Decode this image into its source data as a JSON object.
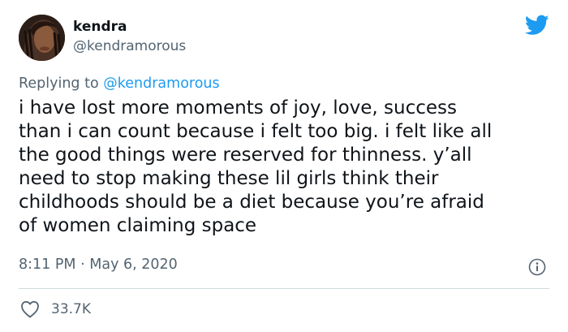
{
  "author": {
    "name": "kendra",
    "handle": "@kendramorous"
  },
  "reply": {
    "prefix": "Replying to",
    "mention": "@kendramorous"
  },
  "tweet": {
    "text": "i have lost more moments of joy, love, success\nthan i can count because i felt too big. i felt like all\nthe good things were reserved for thinness. y’all\nneed to stop making these lil girls think their\nchildhoods should be a diet because you’re afraid\nof women claiming space",
    "time": "8:11 PM",
    "separator": "·",
    "date": "May 6, 2020"
  },
  "stats": {
    "likes": "33.7K"
  },
  "icons": {
    "logo": "twitter-bird-icon",
    "info": "info-icon",
    "like": "heart-icon"
  },
  "colors": {
    "brand": "#1d9bf0",
    "secondary_text": "#536471",
    "primary_text": "#0f1419",
    "divider": "#cfd9de"
  }
}
